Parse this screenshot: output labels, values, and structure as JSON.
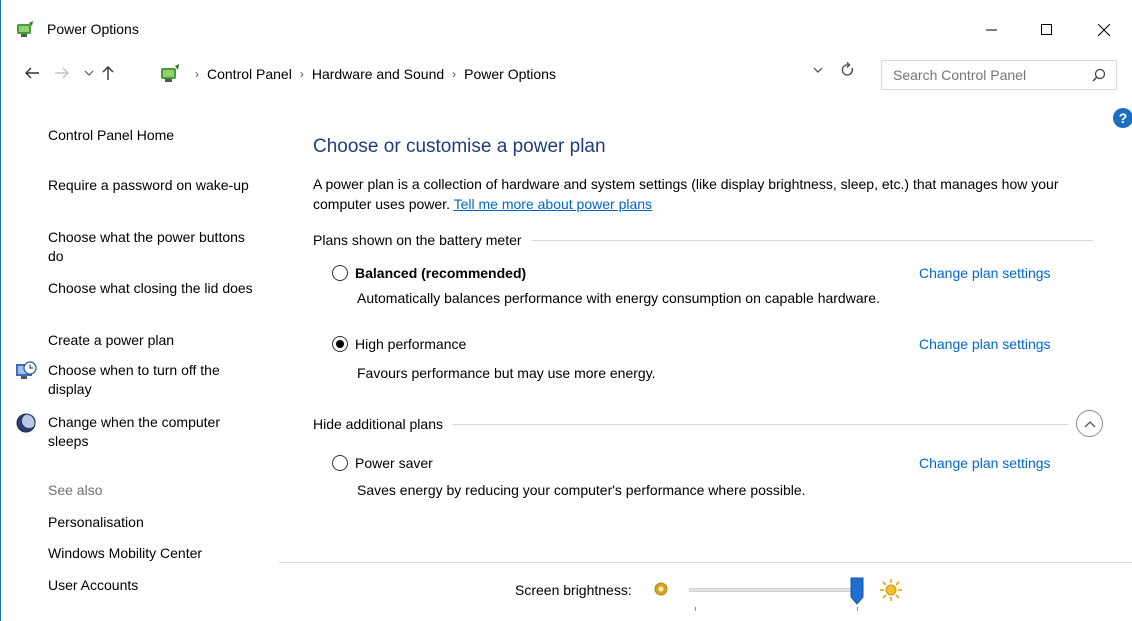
{
  "window": {
    "title": "Power Options"
  },
  "addressbar": {
    "crumbs": [
      "Control Panel",
      "Hardware and Sound",
      "Power Options"
    ],
    "search_placeholder": "Search Control Panel"
  },
  "sidebar": {
    "home": "Control Panel Home",
    "items": [
      "Require a password on wake-up",
      "Choose what the power buttons do",
      "Choose what closing the lid does",
      "Create a power plan",
      "Choose when to turn off the display",
      "Change when the computer sleeps"
    ],
    "see_also_label": "See also",
    "see_also": [
      "Personalisation",
      "Windows Mobility Center",
      "User Accounts"
    ]
  },
  "main": {
    "title": "Choose or customise a power plan",
    "description": "A power plan is a collection of hardware and system settings (like display brightness, sleep, etc.) that manages how your computer uses power.",
    "learn_more": "Tell me more about power plans",
    "section_battery": "Plans shown on the battery meter",
    "section_hidden": "Hide additional plans",
    "plans": [
      {
        "name": "Balanced (recommended)",
        "description": "Automatically balances performance with energy consumption on capable hardware.",
        "link": "Change plan settings",
        "selected": false
      },
      {
        "name": "High performance",
        "description": "Favours performance but may use more energy.",
        "link": "Change plan settings",
        "selected": true
      },
      {
        "name": "Power saver",
        "description": "Saves energy by reducing your computer's performance where possible.",
        "link": "Change plan settings",
        "selected": false
      }
    ]
  },
  "brightness": {
    "label": "Screen brightness:",
    "level_percent": 100
  },
  "colors": {
    "accent": "#0066cc",
    "title": "#1f3d7a",
    "border": "#1e6fb8"
  }
}
